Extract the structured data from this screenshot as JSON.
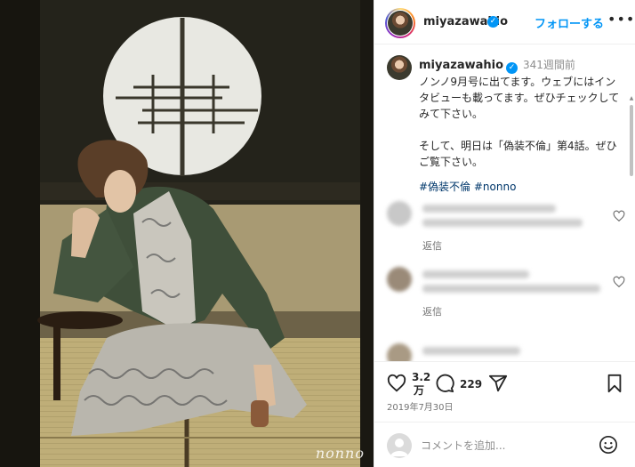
{
  "photo": {
    "watermark": "nonno"
  },
  "post_header": {
    "username": "miyazawahio",
    "verified_mark": "✓",
    "follow_label": "フォローする",
    "more_icon": "•••"
  },
  "caption": {
    "username": "miyazawahio",
    "verified_mark": "✓",
    "time_ago": "341週間前",
    "lines": [
      "ノンノ9月号に出てます。ウェブにはインタビューも載ってます。ぜひチェックしてみて下さい。",
      "そして、明日は「偽装不倫」第4話。ぜひご覧下さい。"
    ],
    "hashtags": "#偽装不倫 #nonno"
  },
  "comments": [
    {
      "reply_label": "返信"
    },
    {
      "reply_label": "返信"
    }
  ],
  "actions": {
    "likes_line1": "3.2",
    "likes_line2": "万",
    "comments_count": "229",
    "date": "2019年7月30日"
  },
  "add_comment": {
    "placeholder": "コメントを追加..."
  },
  "colors": {
    "accent": "#0095f6",
    "hashtag": "#00376b",
    "muted": "#8e8e8e"
  }
}
